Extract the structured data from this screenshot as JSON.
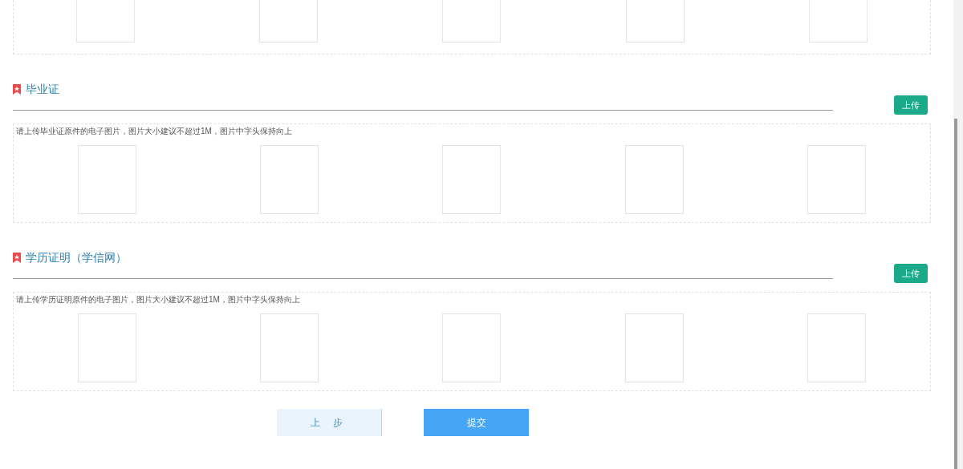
{
  "sections": [
    {
      "kind": "continued"
    },
    {
      "kind": "upload",
      "title": "毕业证",
      "button": "上传",
      "hint": "请上传毕业证原件的电子图片，图片大小建议不超过1M，图片中字头保持向上"
    },
    {
      "kind": "upload",
      "title": "学历证明（学信网）",
      "button": "上传",
      "hint": "请上传学历证明原件的电子图片，图片大小建议不超过1M，图片中字头保持向上"
    }
  ],
  "actions": [
    {
      "kind": "secondary",
      "label": "上 步"
    },
    {
      "kind": "primary",
      "label": "提交"
    }
  ]
}
